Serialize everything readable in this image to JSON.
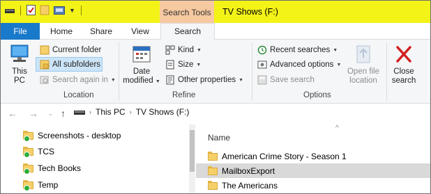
{
  "window": {
    "context_tab": "Search Tools",
    "title": "TV Shows (F:)"
  },
  "tabs": {
    "file": "File",
    "home": "Home",
    "share": "Share",
    "view": "View",
    "search": "Search"
  },
  "ribbon": {
    "location": {
      "this_pc": "This\nPC",
      "current_folder": "Current folder",
      "all_subfolders": "All subfolders",
      "search_again_in": "Search again in",
      "label": "Location"
    },
    "refine": {
      "date_modified_line1": "Date",
      "date_modified_line2": "modified",
      "kind": "Kind",
      "size": "Size",
      "other_properties": "Other properties",
      "label": "Refine"
    },
    "options": {
      "recent_searches": "Recent searches",
      "advanced_options": "Advanced options",
      "save_search": "Save search",
      "open_file_location_line1": "Open file",
      "open_file_location_line2": "location",
      "close_search_line1": "Close",
      "close_search_line2": "search",
      "label": "Options"
    }
  },
  "address": {
    "crumbs": [
      "This PC",
      "TV Shows (F:)"
    ]
  },
  "nav_pane": {
    "items": [
      "Screenshots - desktop",
      "TCS",
      "Tech Books",
      "Temp"
    ]
  },
  "file_list": {
    "column_name": "Name",
    "rows": [
      "American Crime Story - Season 1",
      "MailboxExport",
      "The Americans"
    ],
    "selected_index": 1
  },
  "colors": {
    "titlebar": "#f3f318",
    "file_tab": "#1979ca",
    "context_tab": "#f7c9a0",
    "ribbon_bg": "#f5f6f7",
    "selection": "#cce4f7"
  }
}
